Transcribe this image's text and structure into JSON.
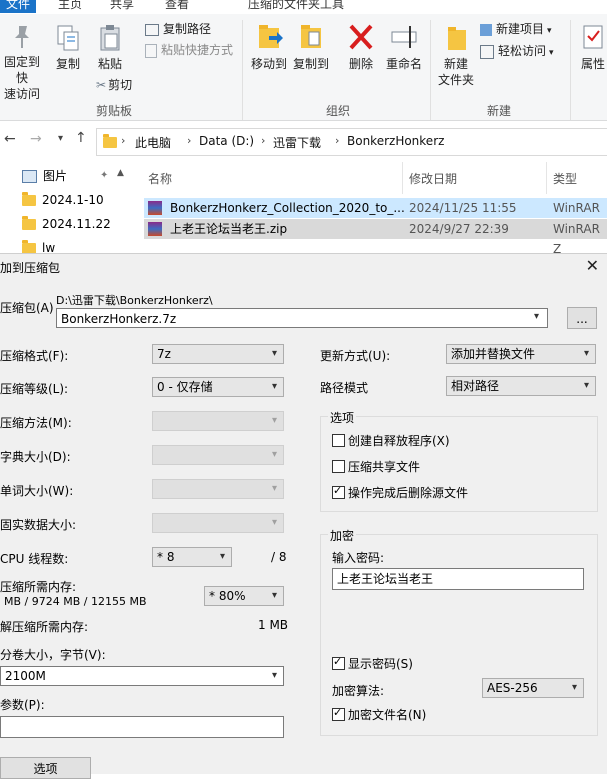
{
  "ribbon": {
    "tabs": [
      "文件",
      "主页",
      "共享",
      "查看",
      "压缩的文件夹工具"
    ],
    "pin_label": [
      "固定到快",
      "速访问"
    ],
    "copy_label": "复制",
    "paste_label": "粘贴",
    "copy_path_label": "复制路径",
    "paste_shortcut_label": "粘贴快捷方式",
    "cut_label": "剪切",
    "clipboard_group": "剪贴板",
    "move_to_label": "移动到",
    "copy_to_label": "复制到",
    "delete_label": "删除",
    "rename_label": "重命名",
    "organize_group": "组织",
    "new_folder_label": [
      "新建",
      "文件夹"
    ],
    "new_item_label": "新建项目",
    "easy_access_label": "轻松访问",
    "new_group": "新建",
    "properties_label": "属性"
  },
  "address": {
    "crumbs": [
      "此电脑",
      "Data (D:)",
      "迅雷下载",
      "BonkerzHonkerz"
    ]
  },
  "nav": {
    "items": [
      "图片",
      "2024.1-10",
      "2024.11.22",
      "lw"
    ]
  },
  "filelist": {
    "headers": {
      "name": "名称",
      "modified": "修改日期",
      "type": "类型"
    },
    "rows": [
      {
        "name": "BonkerzHonkerz_Collection_2020_to_...",
        "modified": "2024/11/25 11:55",
        "type": "WinRAR Z"
      },
      {
        "name": "上老王论坛当老王.zip",
        "modified": "2024/9/27 22:39",
        "type": "WinRAR Z"
      }
    ]
  },
  "dialog": {
    "title": "加到压缩包",
    "archive_label": "压缩包(A)",
    "archive_dir": "D:\\迅雷下载\\BonkerzHonkerz\\",
    "archive_name": "BonkerzHonkerz.7z",
    "browse_label": "...",
    "format_label": "压缩格式(F):",
    "format_value": "7z",
    "level_label": "压缩等级(L):",
    "level_value": "0 - 仅存储",
    "method_label": "压缩方法(M):",
    "dict_label": "字典大小(D):",
    "word_label": "单词大小(W):",
    "solid_label": "固实数据大小:",
    "threads_label": "CPU 线程数:",
    "threads_value": "* 8",
    "threads_max": "/ 8",
    "mem_label": "压缩所需内存:",
    "mem_value": "MB / 9724 MB / 12155 MB",
    "mem_pct": "* 80%",
    "decomp_label": "解压缩所需内存:",
    "decomp_value": "1 MB",
    "split_label": "分卷大小，字节(V):",
    "split_value": "2100M",
    "params_label": "参数(P):",
    "params_value": "",
    "update_label": "更新方式(U):",
    "update_value": "添加并替换文件",
    "path_label": "路径模式",
    "path_value": "相对路径",
    "options_group": "选项",
    "opt_sfx": "创建自释放程序(X)",
    "opt_shared": "压缩共享文件",
    "opt_delete": "操作完成后删除源文件",
    "encrypt_group": "加密",
    "password_label": "输入密码:",
    "password_value": "上老王论坛当老王",
    "show_password": "显示密码(S)",
    "enc_method_label": "加密算法:",
    "enc_method_value": "AES-256",
    "encrypt_names": "加密文件名(N)",
    "options_button": "选项"
  }
}
